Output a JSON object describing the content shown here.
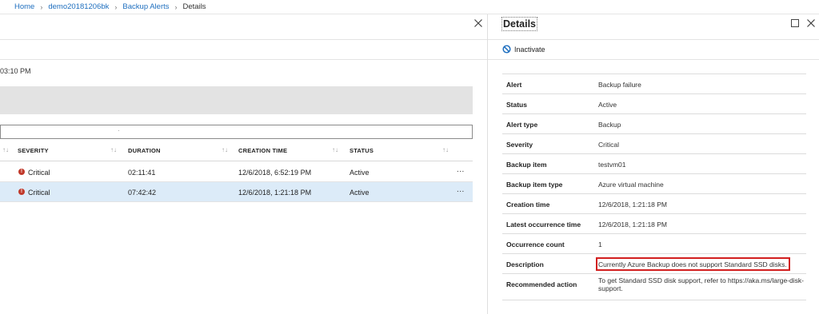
{
  "breadcrumb": {
    "items": [
      "Home",
      "demo20181206bk",
      "Backup Alerts"
    ],
    "current": "Details"
  },
  "left_blade": {
    "time_fragment": "03:10 PM",
    "columns": [
      "SEVERITY",
      "DURATION",
      "CREATION TIME",
      "STATUS"
    ],
    "rows": [
      {
        "severity": "Critical",
        "duration": "02:11:41",
        "creation_time": "12/6/2018, 6:52:19 PM",
        "status": "Active",
        "more": "...",
        "selected": false
      },
      {
        "severity": "Critical",
        "duration": "07:42:42",
        "creation_time": "12/6/2018, 1:21:18 PM",
        "status": "Active",
        "more": "...",
        "selected": true
      }
    ]
  },
  "details": {
    "title": "Details",
    "inactivate_label": "Inactivate",
    "properties": [
      {
        "label": "Alert",
        "value": "Backup failure"
      },
      {
        "label": "Status",
        "value": "Active"
      },
      {
        "label": "Alert type",
        "value": "Backup"
      },
      {
        "label": "Severity",
        "value": "Critical"
      },
      {
        "label": "Backup item",
        "value": "testvm01"
      },
      {
        "label": "Backup item type",
        "value": "Azure virtual machine"
      },
      {
        "label": "Creation time",
        "value": "12/6/2018, 1:21:18 PM"
      },
      {
        "label": "Latest occurrence time",
        "value": "12/6/2018, 1:21:18 PM"
      },
      {
        "label": "Occurrence count",
        "value": "1"
      },
      {
        "label": "Description",
        "value": "Currently Azure Backup does not support Standard SSD disks."
      },
      {
        "label": "Recommended action",
        "value": "To get Standard SSD disk support, refer to https://aka.ms/large-disk-support."
      }
    ]
  },
  "colors": {
    "link": "#1f6fbf",
    "selected_row": "#dcebf8",
    "critical": "#c0392b",
    "highlight_border": "#d21f1f",
    "inactivate_icon": "#1f6fbf"
  },
  "icons": {
    "close": "close-icon",
    "maximize": "maximize-icon",
    "inactivate": "ban-icon",
    "sort": "sort-icon",
    "severity": "error-icon",
    "more": "more-icon"
  }
}
